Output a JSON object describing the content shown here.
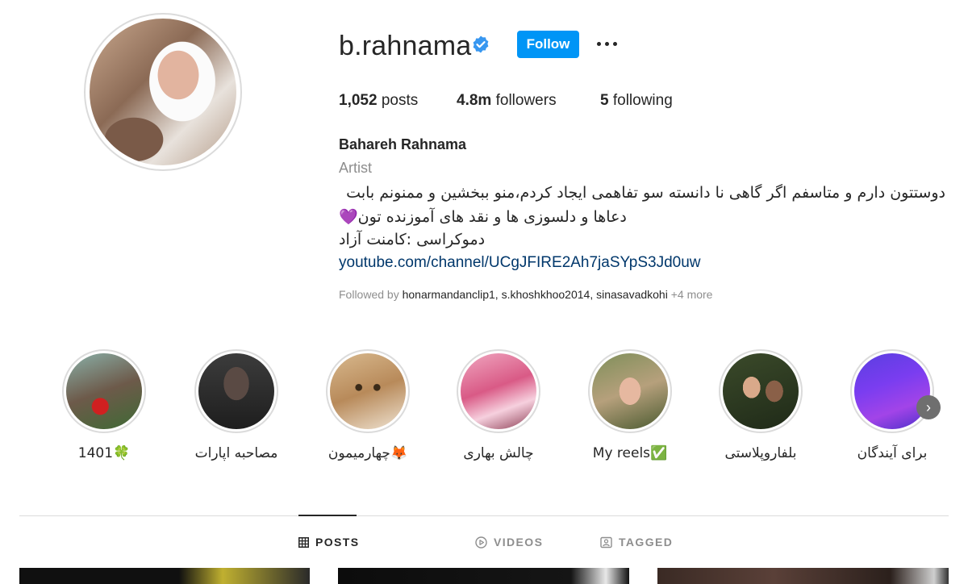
{
  "profile": {
    "username": "b.rahnama",
    "follow_label": "Follow",
    "stats": {
      "posts_count": "1,052",
      "posts_label": "posts",
      "followers_count": "4.8m",
      "followers_label": "followers",
      "following_count": "5",
      "following_label": "following"
    },
    "full_name": "Bahareh Rahnama",
    "category": "Artist",
    "bio_lines": [
      "دوستتون دارم و متاسفم اگر گاهی نا دانسته سو تفاهمی ایجاد کردم،منو ببخشین و ممنونم بابت",
      "دعاها و دلسوزی ها و نقد های آموزنده تون💜",
      "دموکراسی :کامنت آزاد"
    ],
    "link": "youtube.com/channel/UCgJFIRE2Ah7jaSYpS3Jd0uw",
    "followed_by": {
      "prefix": "Followed by",
      "users": "honarmandanclip1, s.khoshkhoo2014, sinasavadkohi",
      "more": "+4 more"
    }
  },
  "highlights": [
    {
      "label": "1401🍀"
    },
    {
      "label": "مصاحبه اپارات"
    },
    {
      "label": "چهارمیمون🦊"
    },
    {
      "label": "چالش بهاری"
    },
    {
      "label": "My reels✅"
    },
    {
      "label": "بلفاروپلاستی"
    },
    {
      "label": "برای آیندگان"
    }
  ],
  "tabs": [
    {
      "label": "POSTS",
      "icon": "grid-icon",
      "active": true
    },
    {
      "label": "VIDEOS",
      "icon": "play-icon",
      "active": false
    },
    {
      "label": "TAGGED",
      "icon": "tag-icon",
      "active": false
    }
  ],
  "colors": {
    "accent": "#0095f6",
    "verified": "#3897f0",
    "link": "#00376b",
    "muted": "#8e8e8e"
  }
}
